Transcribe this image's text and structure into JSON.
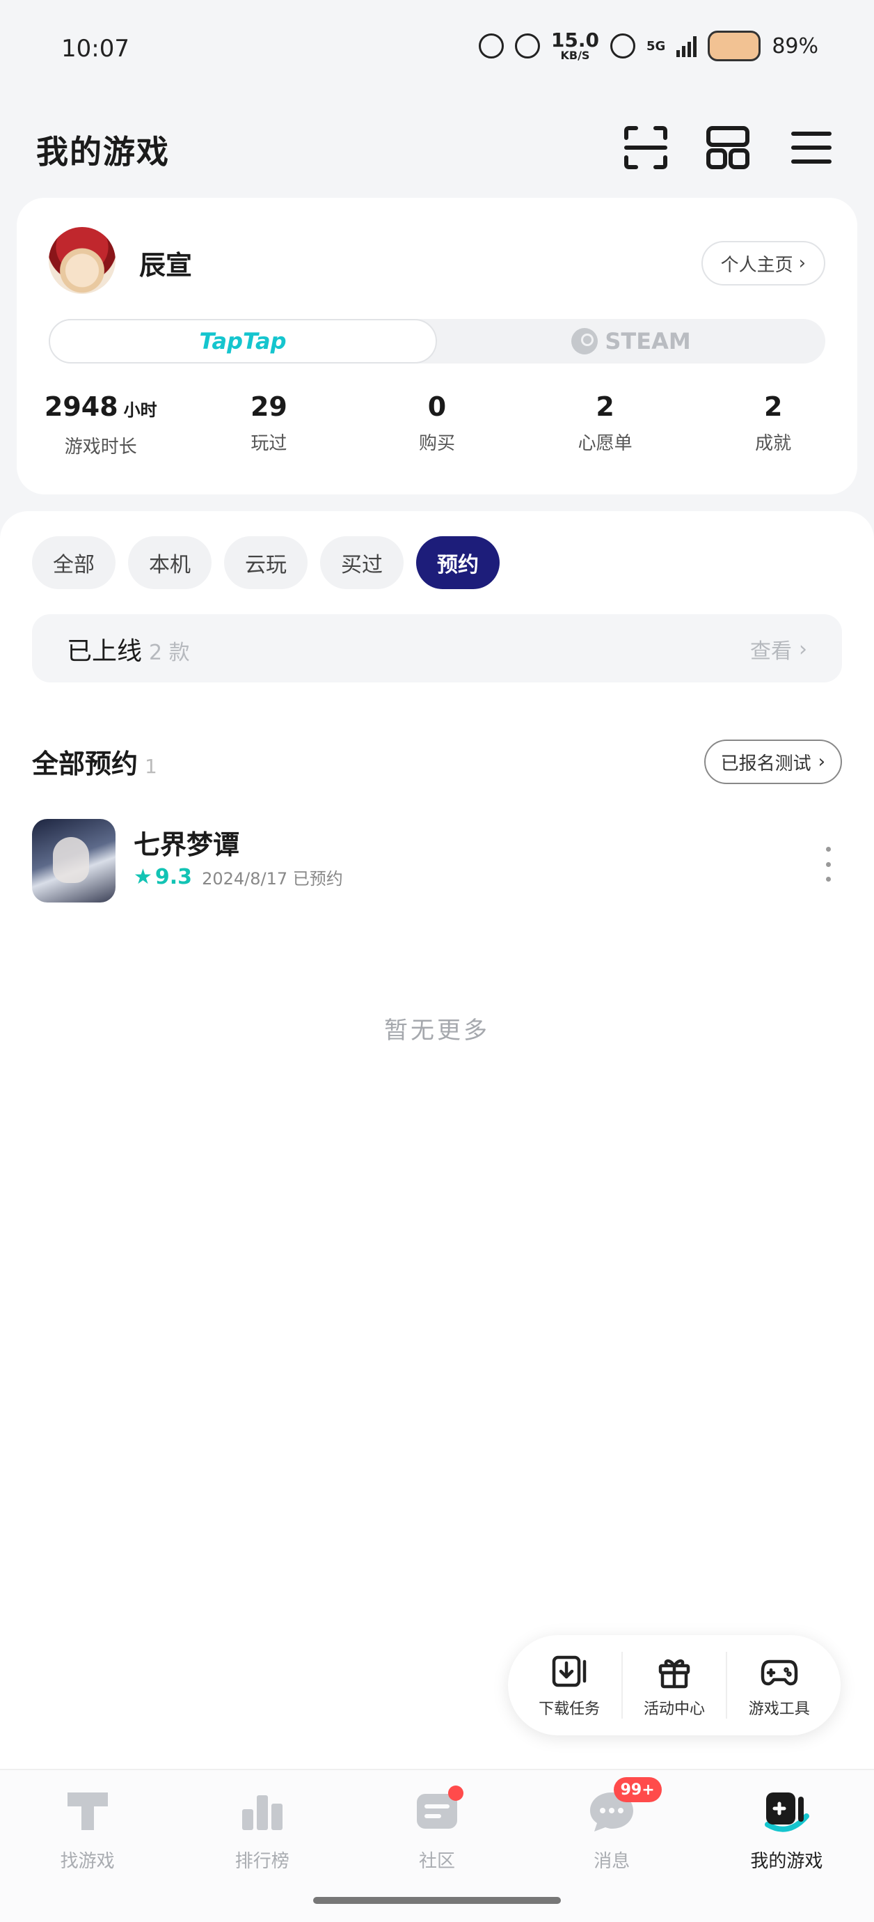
{
  "status_bar": {
    "time": "10:07",
    "net_speed_value": "15.0",
    "net_speed_unit": "KB/S",
    "network": "5G",
    "battery": "89%"
  },
  "header": {
    "title": "我的游戏",
    "icons": [
      "scan-icon",
      "grid-icon",
      "menu-icon"
    ]
  },
  "profile": {
    "username": "辰宣",
    "profile_link": "个人主页",
    "platforms": [
      {
        "label": "TapTap",
        "active": true
      },
      {
        "label": "STEAM",
        "active": false
      }
    ],
    "stats": [
      {
        "value": "2948",
        "unit": "小时",
        "label": "游戏时长"
      },
      {
        "value": "29",
        "unit": "",
        "label": "玩过"
      },
      {
        "value": "0",
        "unit": "",
        "label": "购买"
      },
      {
        "value": "2",
        "unit": "",
        "label": "心愿单"
      },
      {
        "value": "2",
        "unit": "",
        "label": "成就"
      }
    ]
  },
  "filters": [
    {
      "label": "全部",
      "active": false
    },
    {
      "label": "本机",
      "active": false
    },
    {
      "label": "云玩",
      "active": false
    },
    {
      "label": "买过",
      "active": false
    },
    {
      "label": "预约",
      "active": true
    }
  ],
  "released": {
    "label": "已上线",
    "count": "2 款",
    "view": "查看"
  },
  "section": {
    "title": "全部预约",
    "count": "1",
    "signup_button": "已报名测试"
  },
  "games": [
    {
      "name": "七界梦谭",
      "rating": "9.3",
      "status": "2024/8/17 已预约"
    }
  ],
  "empty_hint": "暂无更多",
  "float_bar": [
    {
      "label": "下载任务",
      "icon": "download-icon"
    },
    {
      "label": "活动中心",
      "icon": "gift-icon"
    },
    {
      "label": "游戏工具",
      "icon": "gamepad-icon"
    }
  ],
  "bottom_nav": [
    {
      "label": "找游戏",
      "icon": "taptap-icon"
    },
    {
      "label": "排行榜",
      "icon": "ranking-icon"
    },
    {
      "label": "社区",
      "icon": "community-icon"
    },
    {
      "label": "消息",
      "icon": "message-icon",
      "badge": "99+"
    },
    {
      "label": "我的游戏",
      "icon": "my-games-icon",
      "active": true
    }
  ],
  "colors": {
    "accent_teal": "#15c5ce",
    "filter_active": "#1d1d7a",
    "badge_red": "#ff4b4b"
  }
}
